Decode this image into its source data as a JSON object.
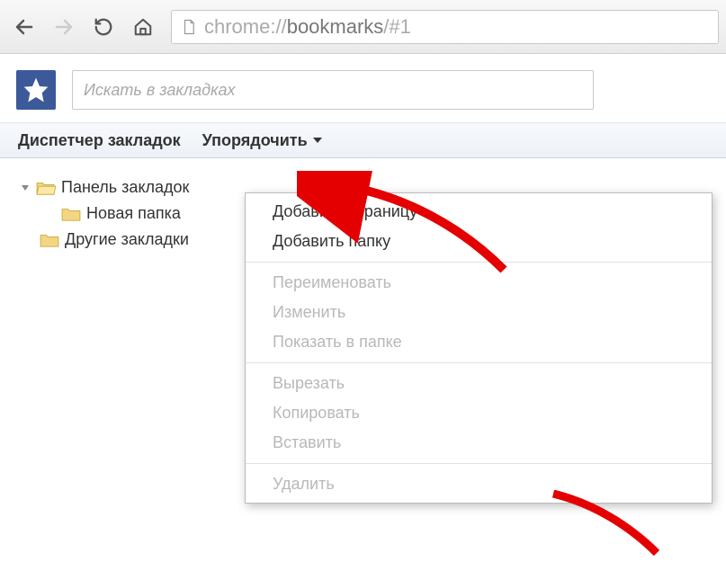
{
  "browser": {
    "url_prefix": "chrome://",
    "url_main": "bookmarks",
    "url_suffix": "/#1"
  },
  "search": {
    "placeholder": "Искать в закладках"
  },
  "manager_bar": {
    "title": "Диспетчер закладок",
    "organize": "Упорядочить"
  },
  "tree": {
    "bookmarks_bar": "Панель закладок",
    "new_folder": "Новая папка",
    "other": "Другие закладки"
  },
  "menu": {
    "add_page": "Добавить страницу",
    "add_folder": "Добавить папку",
    "rename": "Переименовать",
    "edit": "Изменить",
    "show_in_folder": "Показать в папке",
    "cut": "Вырезать",
    "copy": "Копировать",
    "paste": "Вставить",
    "delete": "Удалить"
  }
}
